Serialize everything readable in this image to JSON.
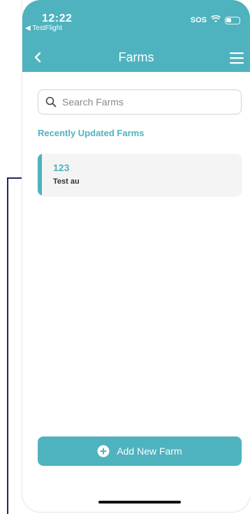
{
  "status_bar": {
    "time": "12:22",
    "back_app": "◀ TestFlight",
    "carrier": "SOS",
    "icons": [
      "wifi-icon",
      "battery-icon"
    ]
  },
  "nav": {
    "title": "Farms",
    "back_icon": "chevron-left-icon",
    "menu_icon": "hamburger-menu-icon"
  },
  "search": {
    "placeholder": "Search Farms",
    "value": "",
    "icon": "search-icon"
  },
  "recent_section": {
    "title": "Recently Updated Farms"
  },
  "farms": [
    {
      "name": "123",
      "subtitle": "Test au"
    }
  ],
  "footer": {
    "add_button_label": "Add New Farm",
    "add_icon": "plus-circle-icon"
  },
  "colors": {
    "brand": "#4fb2bf",
    "text_dark": "#333333",
    "card_bg": "#f4f4f4"
  }
}
